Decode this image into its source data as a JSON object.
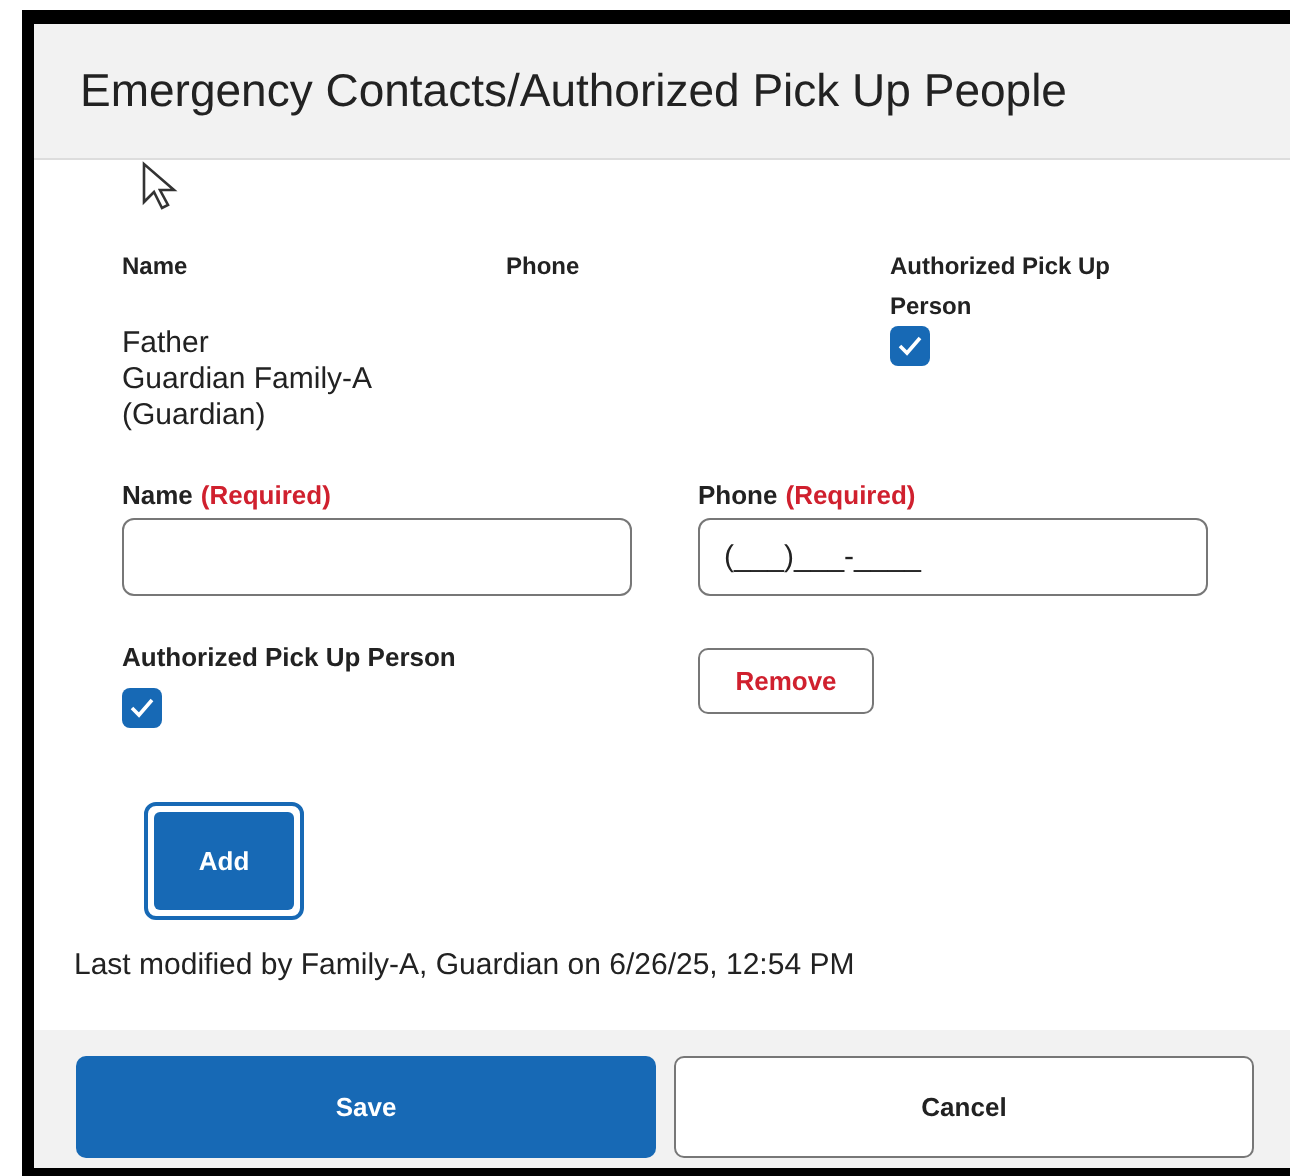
{
  "window": {
    "title": "Emergency Contacts/Authorized Pick Up People"
  },
  "contacts_table": {
    "columns": [
      "Name",
      "Phone",
      "Authorized Pick Up Person"
    ],
    "rows": [
      {
        "name": "Father\nGuardian Family-A\n(Guardian)",
        "authorized": true
      }
    ]
  },
  "new_contact": {
    "name_label": "Name",
    "name_required": "(Required)",
    "phone_label": "Phone",
    "phone_required": "(Required)",
    "phone_value": "(___)___-____",
    "authorized_label": "Authorized Pick Up Person",
    "authorized": true,
    "remove_button": "Remove"
  },
  "add_button": {
    "label": "Add",
    "focused": true
  },
  "last_modified": "Last modified by Family-A, Guardian on 6/26/25, 12:54 PM",
  "buttons": [
    {
      "label": "Save",
      "kind": "primary"
    },
    {
      "label": "Cancel",
      "kind": "secondary"
    }
  ]
}
